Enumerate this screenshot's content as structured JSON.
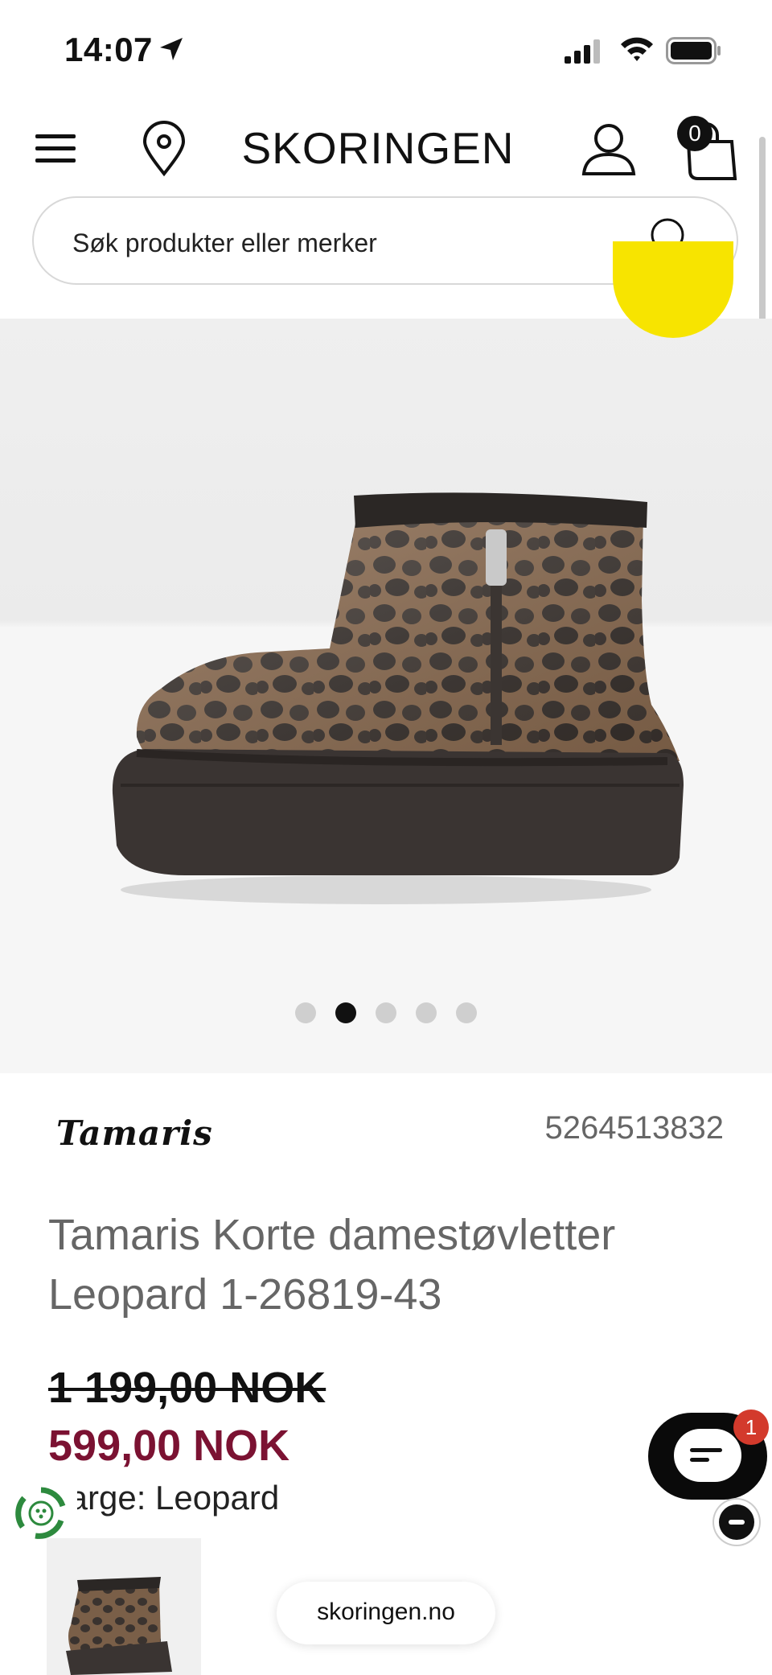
{
  "status_bar": {
    "time": "14:07",
    "icons": [
      "location-arrow-icon",
      "signal-icon",
      "wifi-icon",
      "battery-icon"
    ]
  },
  "header": {
    "logo": "SKORINGEN",
    "cart_count": "0",
    "icons": [
      "menu-icon",
      "location-pin-icon",
      "account-icon",
      "cart-icon"
    ]
  },
  "search": {
    "placeholder": "Søk produkter eller merker"
  },
  "gallery": {
    "image": "leopard-print-ankle-boot",
    "slide_count": 5,
    "active_slide": 2
  },
  "product": {
    "brand": "Tamaris",
    "sku": "5264513832",
    "title": "Tamaris Korte damestøvletter Leopard 1-26819-43",
    "old_price": "1 199,00 NOK",
    "sale_price": "599,00 NOK",
    "color_line": "Farge: Leopard"
  },
  "chat": {
    "badge": "1"
  },
  "browser": {
    "url": "skoringen.no"
  },
  "colors": {
    "sale_price": "#7b1232",
    "promo_badge": "#f7e400",
    "chat_badge": "#d33a2c"
  }
}
